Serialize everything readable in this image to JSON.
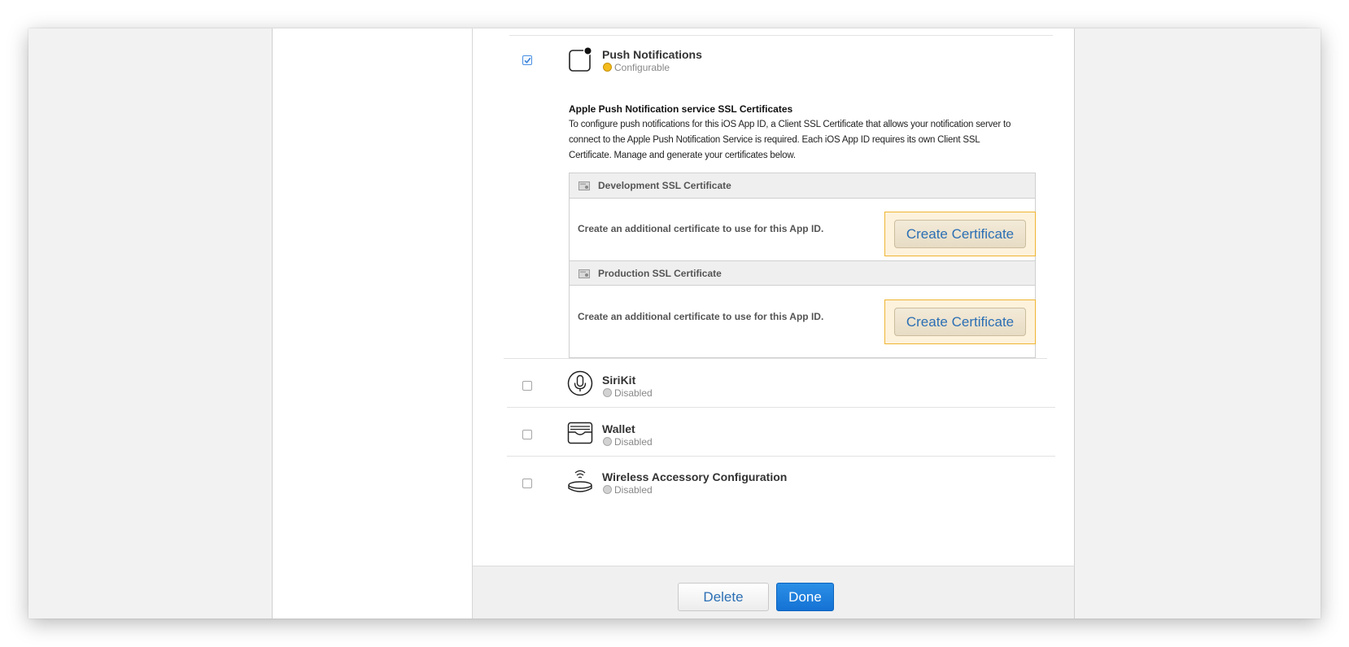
{
  "capabilities": [
    {
      "title": "Push Notifications",
      "status": "Configurable",
      "checked": true,
      "icon": "push-notifications-icon"
    },
    {
      "title": "SiriKit",
      "status": "Disabled",
      "checked": false,
      "icon": "microphone-icon"
    },
    {
      "title": "Wallet",
      "status": "Disabled",
      "checked": false,
      "icon": "wallet-icon"
    },
    {
      "title": "Wireless Accessory Configuration",
      "status": "Disabled",
      "checked": false,
      "icon": "wireless-accessory-icon"
    }
  ],
  "push": {
    "section_title": "Apple Push Notification service SSL Certificates",
    "description": "To configure push notifications for this iOS App ID, a Client SSL Certificate that allows your notification server to connect to the Apple Push Notification Service is required. Each iOS App ID requires its own Client SSL Certificate. Manage and generate your certificates below.",
    "development": {
      "header": "Development SSL Certificate",
      "text": "Create an additional certificate to use for this App ID.",
      "button": "Create Certificate"
    },
    "production": {
      "header": "Production SSL Certificate",
      "text": "Create an additional certificate to use for this App ID.",
      "button": "Create Certificate"
    }
  },
  "footer": {
    "delete_label": "Delete",
    "done_label": "Done"
  },
  "colors": {
    "configurable_dot": "#f3bb1b",
    "disabled_dot": "#d2d2d2",
    "link_blue": "#2b6fb4",
    "done_blue": "#1472d4",
    "highlight": "#f0b531"
  }
}
